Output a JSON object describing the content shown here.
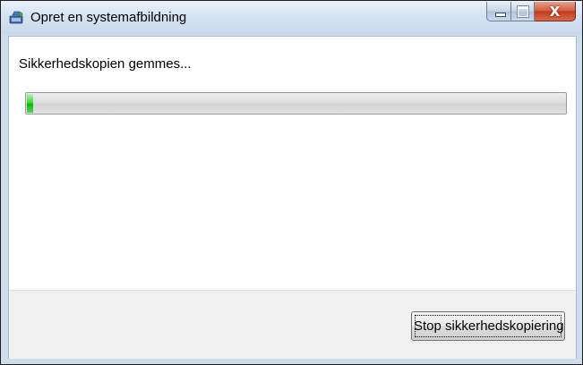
{
  "window": {
    "title": "Opret en systemafbildning",
    "icon": "system-image-backup-icon",
    "caption_buttons": {
      "minimize": "minimize-icon",
      "maximize": "maximize-icon",
      "close_glyph": "X"
    }
  },
  "content": {
    "status_text": "Sikkerhedskopien gemmes...",
    "progress": {
      "fraction": 0.012,
      "color": "#12b312"
    }
  },
  "footer": {
    "stop_button_label": "Stop sikkerhedskopiering"
  }
}
